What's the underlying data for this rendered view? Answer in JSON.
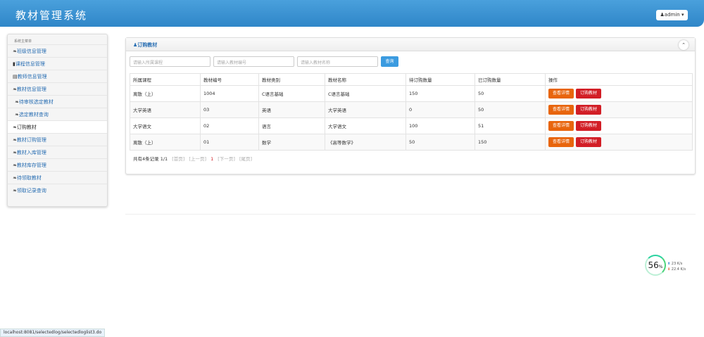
{
  "header": {
    "title": "教材管理系统",
    "user": "admin"
  },
  "sidebar": {
    "heading": "系统主菜单",
    "items": [
      {
        "label": "班级信息管理",
        "icon": "leaf-icon"
      },
      {
        "label": "课程信息管理",
        "icon": "book-icon"
      },
      {
        "label": "教师信息管理",
        "icon": "list-icon"
      },
      {
        "label": "教材信息管理",
        "icon": "leaf-icon"
      },
      {
        "label": "待审核选定教材",
        "icon": "leaf-icon"
      },
      {
        "label": "选定教材查询",
        "icon": "leaf-icon"
      },
      {
        "label": "订购教材",
        "icon": "leaf-icon",
        "active": true
      },
      {
        "label": "教材订购管理",
        "icon": "leaf-icon"
      },
      {
        "label": "教材入库管理",
        "icon": "leaf-icon"
      },
      {
        "label": "教材库存管理",
        "icon": "leaf-icon"
      },
      {
        "label": "待领取教材",
        "icon": "leaf-icon"
      },
      {
        "label": "领取记录查询",
        "icon": "leaf-icon"
      }
    ]
  },
  "panel": {
    "title": "订购教材",
    "search": {
      "course_placeholder": "请输入所属课程",
      "code_placeholder": "请输入教材编号",
      "name_placeholder": "请输入教材名称",
      "button": "查询"
    },
    "columns": [
      "所属课程",
      "教材编号",
      "教材类别",
      "教材名称",
      "待订购数量",
      "已订购数量",
      "操作"
    ],
    "rows": [
      [
        "离散（上）",
        "1004",
        "C语言基础",
        "C语言基础",
        "150",
        "50"
      ],
      [
        "大学英语",
        "03",
        "英语",
        "大学英语",
        "0",
        "50"
      ],
      [
        "大学语文",
        "02",
        "语言",
        "大学语文",
        "100",
        "51"
      ],
      [
        "离散（上）",
        "01",
        "数学",
        "《高等数学》",
        "50",
        "150"
      ]
    ],
    "actions": {
      "detail": "查看详情",
      "order": "订购教材"
    },
    "pager": {
      "summary": "共有4条记录 1/1",
      "first": "[首页]",
      "prev": "[上一页]",
      "current": "1",
      "next": "[下一页]",
      "last": "[尾页]"
    }
  },
  "status_url": "localhost:8081/selectedlog/selectedloglist3.do",
  "net_widget": {
    "percent": "56",
    "unit": "%",
    "up": "23 K/s",
    "down": "22.4 K/s"
  }
}
